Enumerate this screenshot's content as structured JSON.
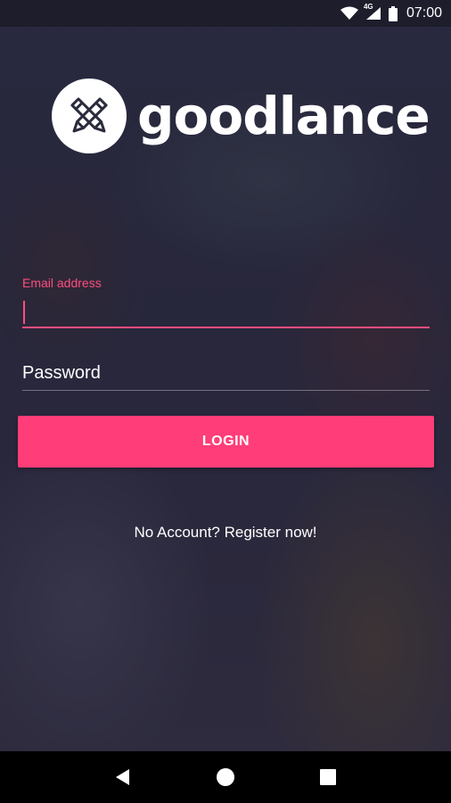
{
  "status_bar": {
    "time": "07:00",
    "network_label": "4G",
    "icons": [
      "wifi-icon",
      "signal-icon",
      "battery-icon"
    ]
  },
  "brand": {
    "name": "goodlance",
    "logo_icon": "crossed-pencils-icon"
  },
  "login_form": {
    "email_label": "Email address",
    "email_value": "",
    "password_placeholder": "Password",
    "login_button": "LOGIN",
    "register_link": "No Account? Register now!"
  },
  "nav_bar": {
    "icons": [
      "back-icon",
      "home-icon",
      "recents-icon"
    ]
  },
  "colors": {
    "accent": "#ff3d78",
    "text": "#ffffff"
  }
}
